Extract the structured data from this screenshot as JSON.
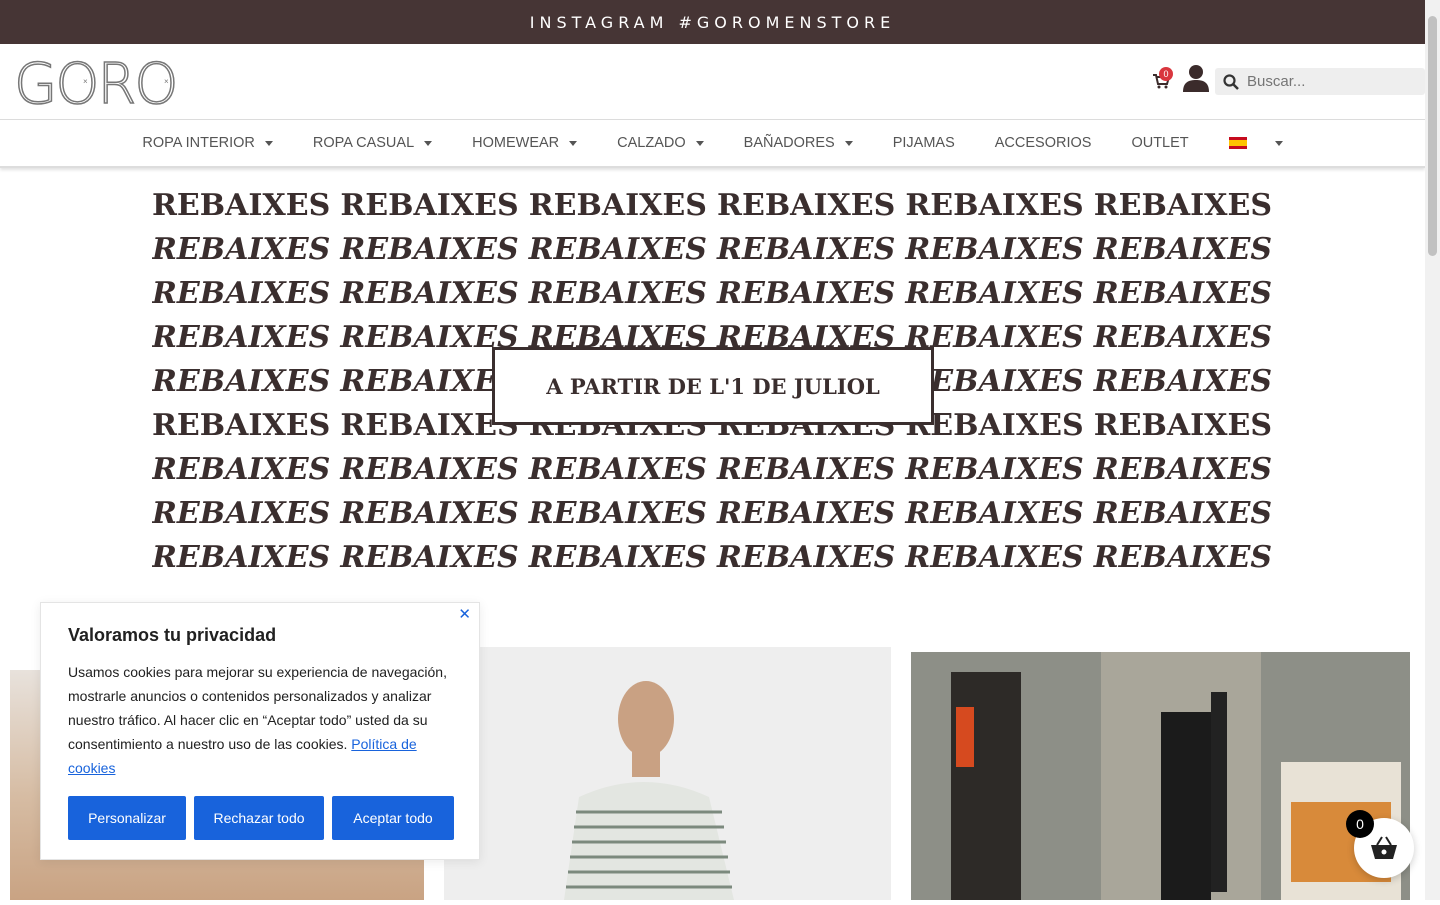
{
  "topbar": {
    "text": "INSTAGRAM #GOROMENSTORE"
  },
  "header": {
    "logo_text": "GORO",
    "cart_count": "0",
    "search_placeholder": "Buscar..."
  },
  "nav": {
    "items": [
      {
        "label": "ROPA INTERIOR"
      },
      {
        "label": "ROPA CASUAL"
      },
      {
        "label": "HOMEWEAR"
      },
      {
        "label": "CALZADO"
      },
      {
        "label": "BAÑADORES"
      },
      {
        "label": "PIJAMAS"
      },
      {
        "label": "ACCESORIOS"
      },
      {
        "label": "OUTLET"
      }
    ]
  },
  "banner": {
    "word": "REBAIXES",
    "box_text": "A PARTIR DE L'1 DE JULIOL"
  },
  "cookie": {
    "title": "Valoramos tu privacidad",
    "body": "Usamos cookies para mejorar su experiencia de navegación, mostrarle anuncios o contenidos personalizados y analizar nuestro tráfico. Al hacer clic en “Aceptar todo” usted da su consentimiento a nuestro uso de las cookies.",
    "link": "Política de cookies",
    "customize": "Personalizar",
    "reject": "Rechazar todo",
    "accept": "Aceptar todo",
    "close": "✕"
  },
  "floating_cart": {
    "count": "0"
  },
  "colors": {
    "topbar_bg": "#463535",
    "button": "#1863dc",
    "badge": "#d9363e"
  }
}
